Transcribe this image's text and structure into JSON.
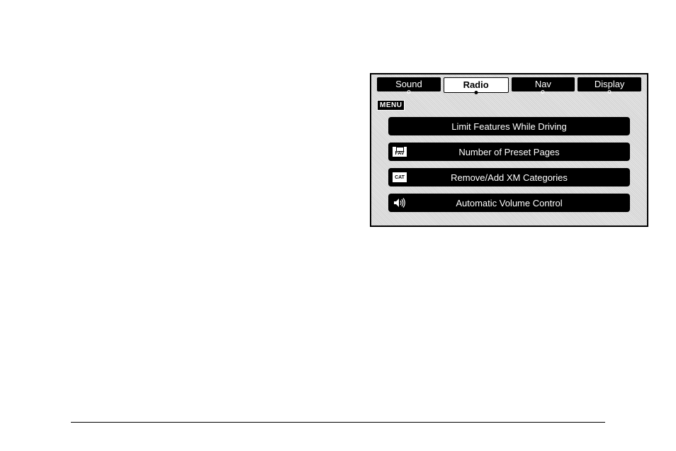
{
  "tabs": {
    "sound": "Sound",
    "radio": "Radio",
    "nav": "Nav",
    "display": "Display"
  },
  "menu_badge": "MENU",
  "menu_items": {
    "limit_features": "Limit Features While Driving",
    "preset_pages": "Number of Preset Pages",
    "xm_categories": "Remove/Add XM Categories",
    "auto_volume": "Automatic Volume Control"
  },
  "icons": {
    "fav": "FAV",
    "cat": "CAT"
  }
}
